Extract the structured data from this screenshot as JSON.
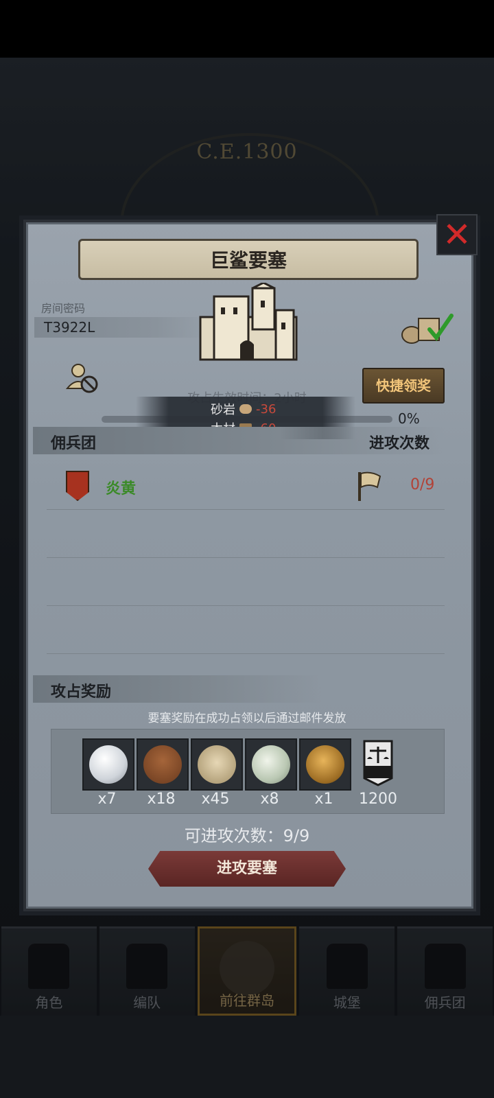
{
  "background": {
    "era_label": "C.E.1300"
  },
  "modal": {
    "title": "巨鲨要塞",
    "room_label": "房间密码",
    "room_code": "T3922L",
    "quick_claim": "快捷领奖",
    "occupy_time": "攻占生效时间：2小时",
    "progress": {
      "value_pct": 0,
      "label": "0%"
    },
    "cost_tooltip": [
      {
        "name": "砂岩",
        "icon": "stone-icon",
        "value": "-36"
      },
      {
        "name": "木材",
        "icon": "wood-icon",
        "value": "-60"
      }
    ],
    "mercenary_header": "佣兵团",
    "attack_count_header": "进攻次数",
    "legion": {
      "name": "炎黄",
      "attack_count": "0/9"
    },
    "reward_header": "攻占奖励",
    "reward_note": "要塞奖励在成功占领以后通过邮件发放",
    "rewards": [
      {
        "icon": "pearl-icon",
        "qty": "x7"
      },
      {
        "icon": "ox-icon",
        "qty": "x18"
      },
      {
        "icon": "grain-sack-icon",
        "qty": "x45"
      },
      {
        "icon": "jade-stone-icon",
        "qty": "x8"
      },
      {
        "icon": "knight-helmet-medal-icon",
        "qty": "x1"
      },
      {
        "icon": "justice-banner-icon",
        "qty": "1200"
      }
    ],
    "attempts": "可进攻次数：9/9",
    "attack_button": "进攻要塞"
  },
  "bottom_nav": [
    {
      "label": "角色",
      "icon": "knight-icon"
    },
    {
      "label": "编队",
      "icon": "formation-icon"
    },
    {
      "label": "前往群岛",
      "icon": "islands-compass-icon",
      "active": true
    },
    {
      "label": "城堡",
      "icon": "castle-icon"
    },
    {
      "label": "佣兵团",
      "icon": "mercenary-icon"
    }
  ],
  "colors": {
    "accent_red": "#c94a3c",
    "legion_green": "#3b8a28",
    "quick_claim_text": "#f2c57a",
    "close_red": "#d12a2a"
  }
}
